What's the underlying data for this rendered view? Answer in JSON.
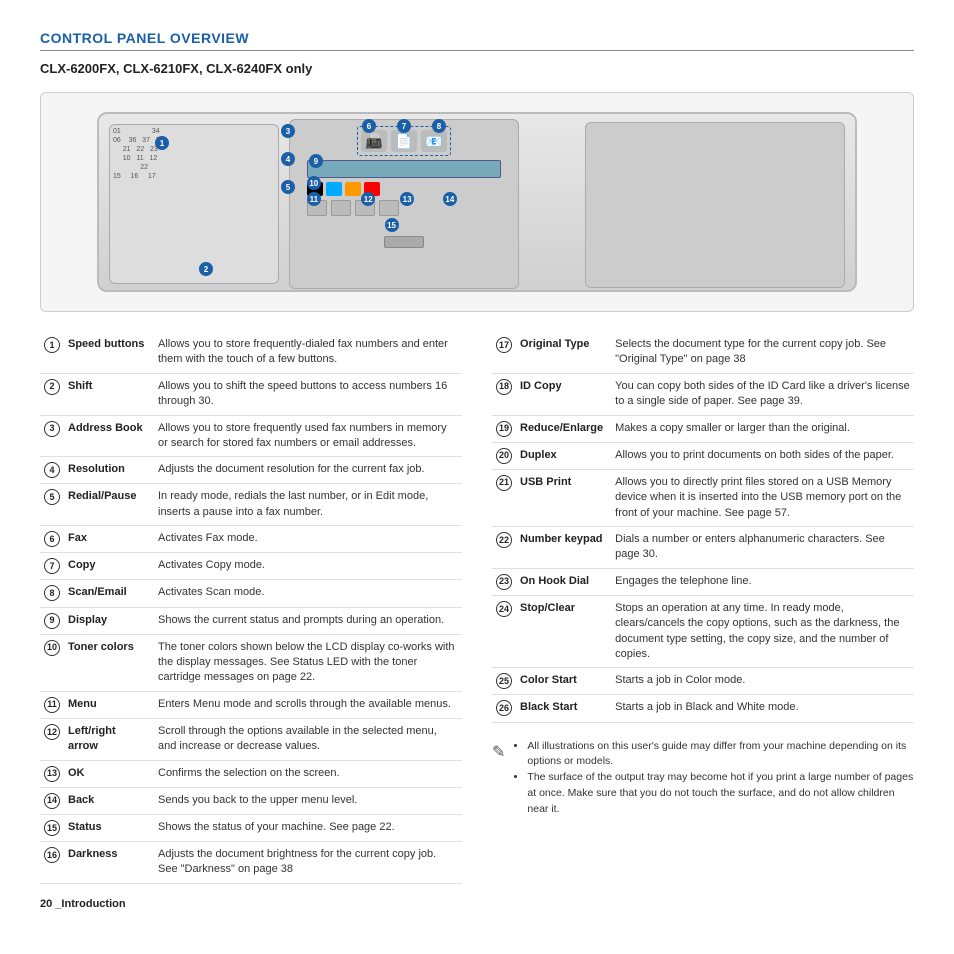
{
  "page": {
    "title": "CONTROL PANEL OVERVIEW",
    "subtitle": "CLX-6200FX, CLX-6210FX, CLX-6240FX only",
    "page_number": "20",
    "page_label": "_Introduction"
  },
  "left_table": [
    {
      "num": "1",
      "name": "Speed buttons",
      "desc": "Allows you to store frequently-dialed fax numbers and enter them with the touch of a few buttons."
    },
    {
      "num": "2",
      "name": "Shift",
      "desc": "Allows you to shift the speed buttons to access numbers 16 through 30."
    },
    {
      "num": "3",
      "name": "Address Book",
      "desc": "Allows you to store frequently used fax numbers in memory or search for stored fax numbers or email addresses."
    },
    {
      "num": "4",
      "name": "Resolution",
      "desc": "Adjusts the document resolution for the current fax job."
    },
    {
      "num": "5",
      "name": "Redial/Pause",
      "desc": "In ready mode, redials the last number, or in Edit mode, inserts a pause into a fax number."
    },
    {
      "num": "6",
      "name": "Fax",
      "desc": "Activates Fax mode."
    },
    {
      "num": "7",
      "name": "Copy",
      "desc": "Activates Copy mode."
    },
    {
      "num": "8",
      "name": "Scan/Email",
      "desc": "Activates Scan mode."
    },
    {
      "num": "9",
      "name": "Display",
      "desc": "Shows the current status and prompts during an operation."
    },
    {
      "num": "10",
      "name": "Toner colors",
      "desc": "The toner colors shown below the LCD display co-works with the display messages. See Status LED with the toner cartridge messages on page 22."
    },
    {
      "num": "11",
      "name": "Menu",
      "desc": "Enters Menu mode and scrolls through the available menus."
    },
    {
      "num": "12",
      "name": "Left/right arrow",
      "desc": "Scroll through the options available in the selected menu, and increase or decrease values."
    },
    {
      "num": "13",
      "name": "OK",
      "desc": "Confirms the selection on the screen."
    },
    {
      "num": "14",
      "name": "Back",
      "desc": "Sends you back to the upper menu level."
    },
    {
      "num": "15",
      "name": "Status",
      "desc": "Shows the status of your machine. See page 22."
    },
    {
      "num": "16",
      "name": "Darkness",
      "desc": "Adjusts the document brightness for the current copy job. See \"Darkness\" on page 38"
    }
  ],
  "right_table": [
    {
      "num": "17",
      "name": "Original Type",
      "desc": "Selects the document type for the current copy job. See \"Original Type\" on page 38"
    },
    {
      "num": "18",
      "name": "ID Copy",
      "desc": "You can copy both sides of the ID Card like a driver's license to a single side of paper. See page 39."
    },
    {
      "num": "19",
      "name": "Reduce/Enlarge",
      "desc": "Makes a copy smaller or larger than the original."
    },
    {
      "num": "20",
      "name": "Duplex",
      "desc": "Allows you to print documents on both sides of the paper."
    },
    {
      "num": "21",
      "name": "USB Print",
      "desc": "Allows you to directly print files stored on a USB Memory device when it is inserted into the USB memory port on the front of your machine. See page 57."
    },
    {
      "num": "22",
      "name": "Number keypad",
      "desc": "Dials a number or enters alphanumeric characters. See page 30."
    },
    {
      "num": "23",
      "name": "On Hook Dial",
      "desc": "Engages the telephone line."
    },
    {
      "num": "24",
      "name": "Stop/Clear",
      "desc": "Stops an operation at any time. In ready mode, clears/cancels the copy options, such as the darkness, the document type setting, the copy size, and the number of copies."
    },
    {
      "num": "25",
      "name": "Color Start",
      "desc": "Starts a job in Color mode."
    },
    {
      "num": "26",
      "name": "Black Start",
      "desc": "Starts a job in Black and White mode."
    }
  ],
  "notes": [
    "All illustrations on this user's guide may differ from your machine depending on its options or models.",
    "The surface of the output tray may become hot if you print a large number of pages at once. Make sure that you do not touch the surface, and do not allow children near it."
  ]
}
